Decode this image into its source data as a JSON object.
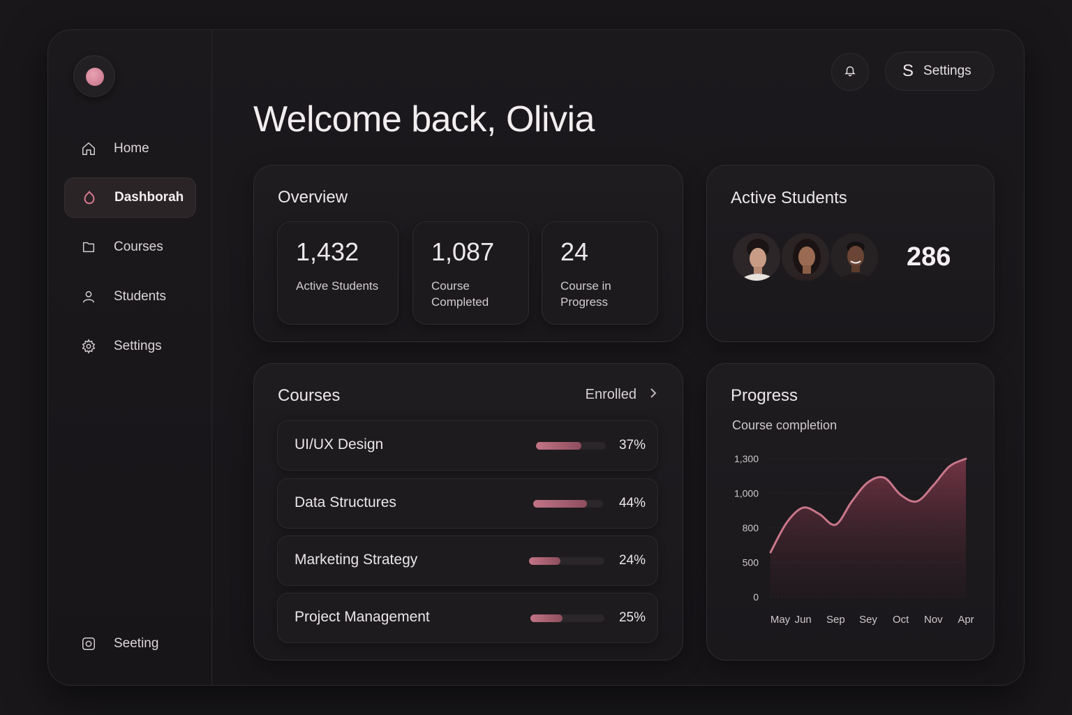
{
  "sidebar": {
    "items": [
      {
        "label": "Home",
        "icon": "home-icon"
      },
      {
        "label": "Dashborah",
        "icon": "dashboard-icon",
        "active": true
      },
      {
        "label": "Courses",
        "icon": "folder-icon"
      },
      {
        "label": "Students",
        "icon": "user-icon"
      },
      {
        "label": "Settings",
        "icon": "gear-icon"
      }
    ],
    "bottom_item": {
      "label": "Seeting",
      "icon": "instagram-icon"
    }
  },
  "header": {
    "settings_letter": "S",
    "settings_label": "Settings",
    "welcome": "Welcome back, Olivia"
  },
  "overview": {
    "title": "Overview",
    "stats": [
      {
        "value": "1,432",
        "label_line1": "Active Students",
        "label_line2": ""
      },
      {
        "value": "1,087",
        "label_line1": "Course",
        "label_line2": "Completed"
      },
      {
        "value": "24",
        "label_line1": "Course in",
        "label_line2": "Progress"
      }
    ]
  },
  "active_students": {
    "title": "Active Students",
    "count": "286"
  },
  "courses": {
    "title": "Courses",
    "filter_label": "Enrolled",
    "items": [
      {
        "name": "UI/UX Design",
        "percent_label": "37%",
        "progress": 0.37
      },
      {
        "name": "Data Structures",
        "percent_label": "44%",
        "progress": 0.44
      },
      {
        "name": "Marketing Strategy",
        "percent_label": "24%",
        "progress": 0.24
      },
      {
        "name": "Project Management",
        "percent_label": "25%",
        "progress": 0.25
      }
    ]
  },
  "progress": {
    "title": "Progress",
    "subtitle": "Course completion"
  },
  "colors": {
    "accent": "#c9778a",
    "background": "#19171a",
    "card": "#1e1c1f"
  },
  "chart_data": {
    "type": "area",
    "x_tick_labels": [
      "May",
      "Jun",
      "Sep",
      "Sey",
      "Oct",
      "Nov",
      "Apr"
    ],
    "y_tick_labels": [
      "1,300",
      "1,000",
      "800",
      "500",
      "0"
    ],
    "series": [
      {
        "x": [
          0,
          0.5,
          1,
          1.5,
          2,
          2.5,
          3,
          3.5,
          4,
          4.5,
          5,
          5.5,
          6
        ],
        "values": [
          420,
          700,
          840,
          780,
          680,
          900,
          1080,
          1120,
          960,
          900,
          1050,
          1230,
          1300
        ]
      }
    ],
    "ylim": [
      0,
      1300
    ],
    "grid": true
  }
}
